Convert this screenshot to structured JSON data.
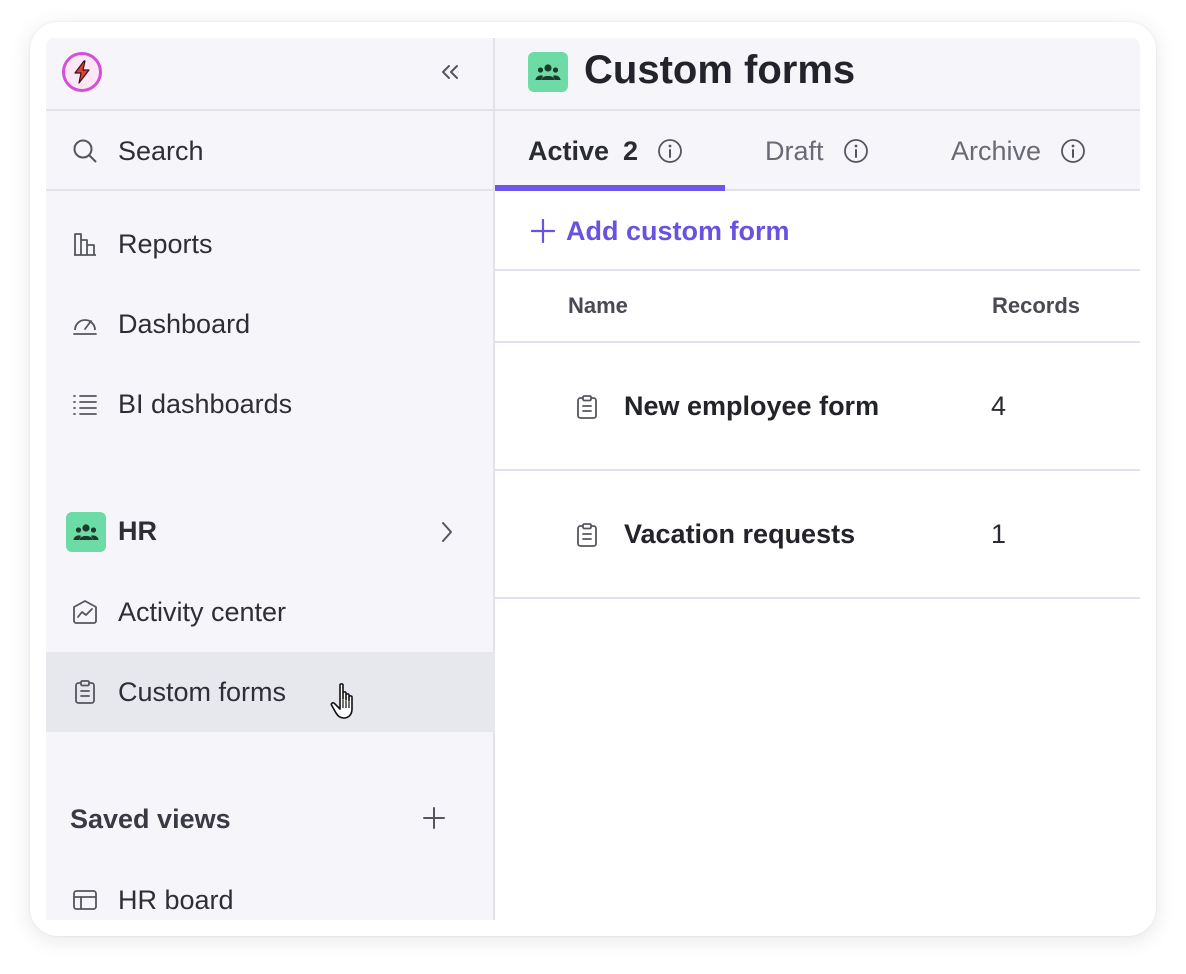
{
  "sidebar": {
    "search_label": "Search",
    "nav": [
      {
        "label": "Reports",
        "icon": "bar-chart-icon"
      },
      {
        "label": "Dashboard",
        "icon": "gauge-icon"
      },
      {
        "label": "BI dashboards",
        "icon": "list-icon"
      }
    ],
    "workspace": {
      "label": "HR",
      "icon": "people-icon"
    },
    "workspace_items": [
      {
        "label": "Activity center",
        "icon": "activity-icon"
      },
      {
        "label": "Custom forms",
        "icon": "clipboard-icon",
        "active": true
      }
    ],
    "saved_views": {
      "heading": "Saved views",
      "items": [
        {
          "label": "HR board",
          "icon": "table-icon"
        }
      ]
    }
  },
  "main": {
    "title": "Custom forms",
    "tabs": [
      {
        "label": "Active",
        "count": "2",
        "active": true
      },
      {
        "label": "Draft",
        "count": ""
      },
      {
        "label": "Archive",
        "count": ""
      }
    ],
    "add_label": "Add custom form",
    "table": {
      "columns": [
        "Name",
        "Records"
      ],
      "rows": [
        {
          "name": "New employee form",
          "records": "4"
        },
        {
          "name": "Vacation requests",
          "records": "1"
        }
      ]
    }
  },
  "colors": {
    "accent": "#6f55e8",
    "badge": "#6ddba5",
    "logo": "#d64fd6",
    "sidebar_bg": "#f6f6fa",
    "active_row": "#e7e7ee"
  }
}
